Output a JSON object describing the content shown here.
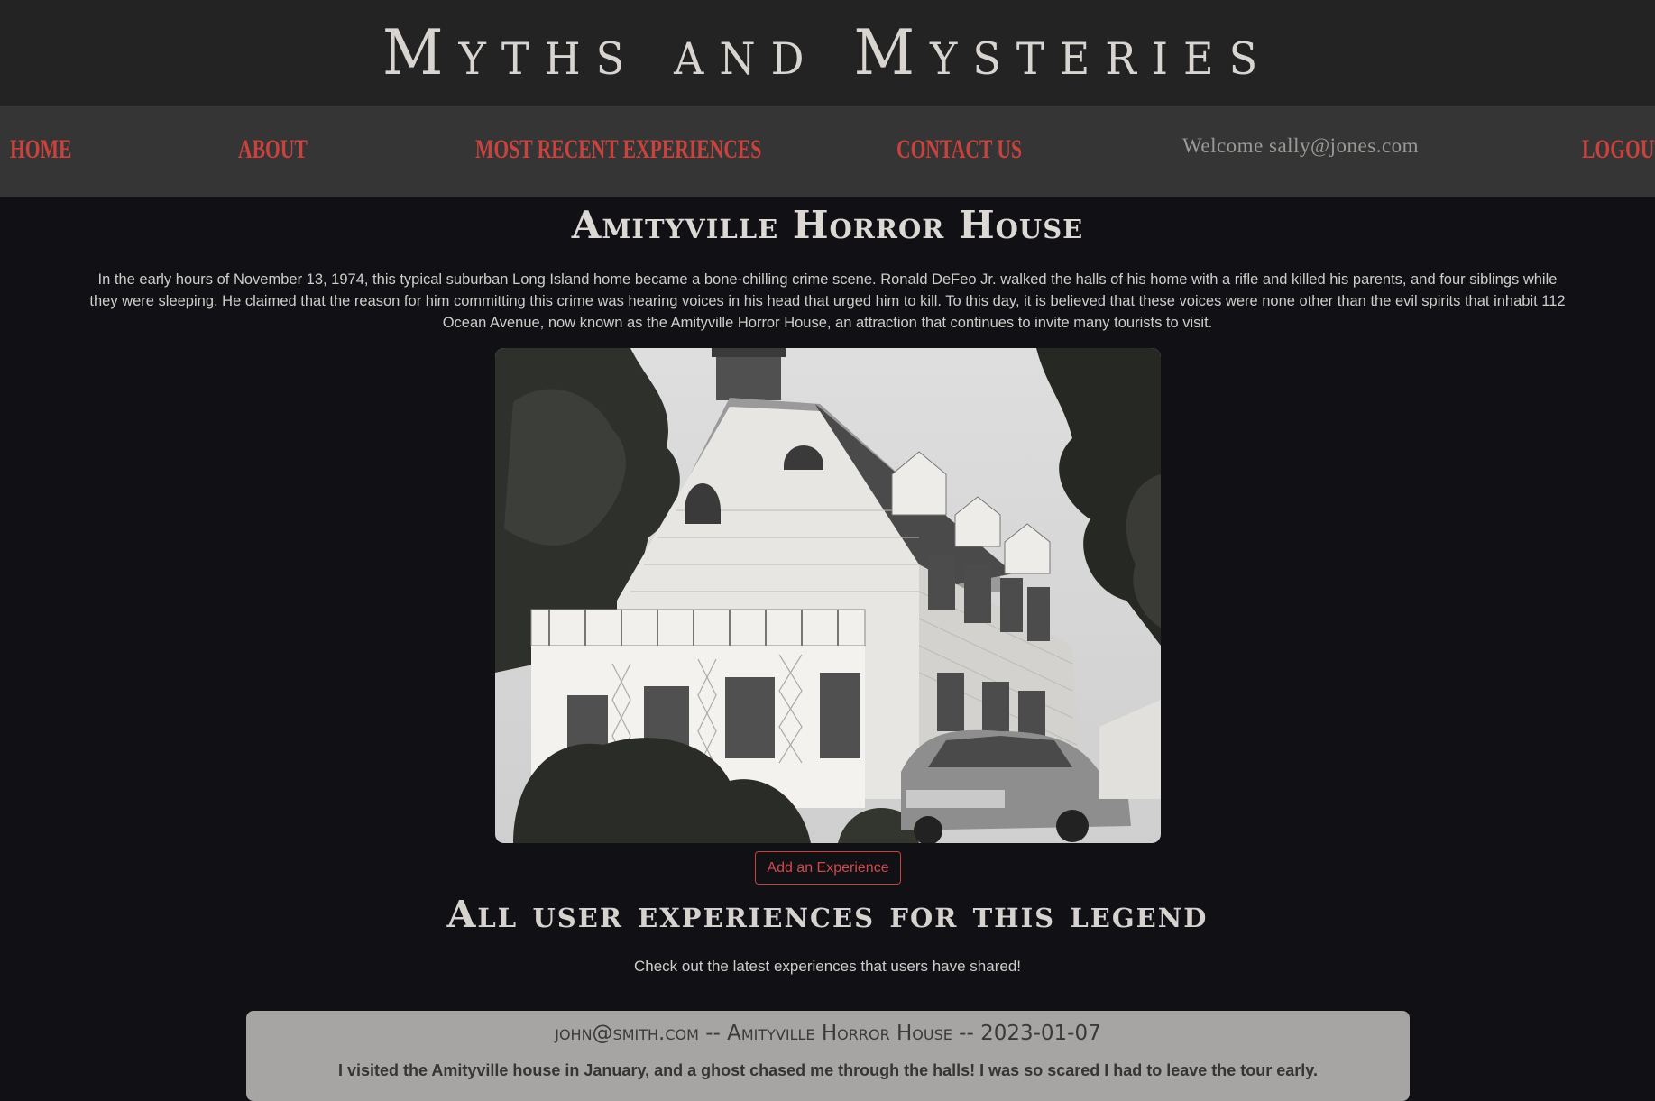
{
  "site": {
    "title": "Myths and Mysteries"
  },
  "nav": {
    "home": "Home",
    "about": "About",
    "recent": "Most Recent Experiences",
    "contact": "Contact Us",
    "welcome": "Welcome sally@jones.com",
    "logout": "Logout"
  },
  "legend": {
    "title": "Amityville Horror House",
    "description": "In the early hours of November 13, 1974, this typical suburban Long Island home became a bone-chilling crime scene. Ronald DeFeo Jr. walked the halls of his home with a rifle and killed his parents, and four siblings while they were sleeping. He claimed that the reason for him committing this crime was hearing voices in his head that urged him to kill. To this day, it is believed that these voices were none other than the evil spirits that inhabit 112 Ocean Avenue, now known as the Amityville Horror House, an attraction that continues to invite many tourists to visit.",
    "photo_alt": "Amityville Horror House"
  },
  "actions": {
    "add_experience": "Add an Experience"
  },
  "experiences": {
    "heading": "All user experiences for this legend",
    "subheading": "Check out the latest experiences that users have shared!",
    "items": [
      {
        "meta": "john@smith.com -- Amityville Horror House -- 2023-01-07",
        "text": "I visited the Amityville house in January, and a ghost chased me through the halls! I was so scared I had to leave the tour early."
      }
    ]
  },
  "colors": {
    "accent": "#c8423e",
    "header_bg": "#232323",
    "nav_bg": "#353535",
    "page_bg": "#111015",
    "card_bg": "#a6a5a3"
  }
}
